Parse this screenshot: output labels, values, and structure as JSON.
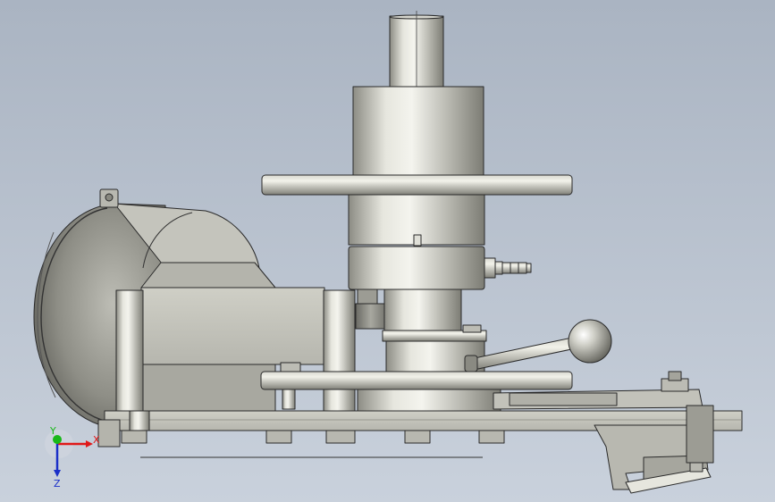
{
  "viewport": {
    "background_top": "#aab4c2",
    "background_bottom": "#c9d1dc"
  },
  "triad": {
    "x_label": "X",
    "y_label": "Y",
    "z_label": "Z",
    "x_color": "#e01818",
    "y_color": "#18b818",
    "z_color": "#1a2fc8"
  },
  "model": {
    "metal_color": "#c8c8c0",
    "edge_color": "#2a2a2a"
  }
}
